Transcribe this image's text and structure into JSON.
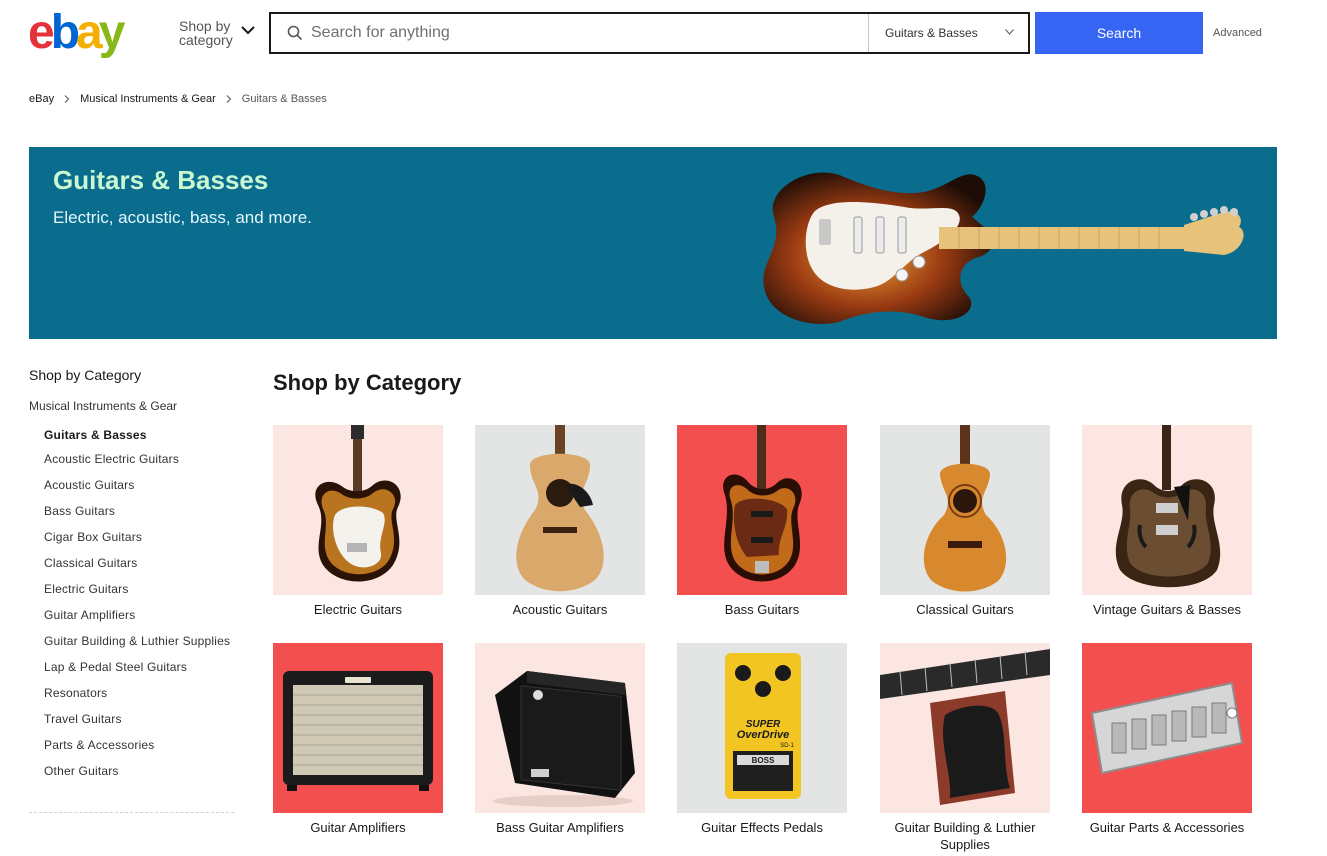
{
  "header": {
    "logo_text": "ebay",
    "shop_by_line1": "Shop by",
    "shop_by_line2": "category",
    "search_placeholder": "Search for anything",
    "category_selected": "Guitars & Basses",
    "search_button": "Search",
    "advanced_link": "Advanced"
  },
  "breadcrumb": [
    "eBay",
    "Musical Instruments & Gear",
    "Guitars & Basses"
  ],
  "hero": {
    "title": "Guitars & Basses",
    "subtitle": "Electric, acoustic, bass, and more.",
    "background": "#0a6d8e"
  },
  "sidebar": {
    "title": "Shop by Category",
    "parent": "Musical Instruments & Gear",
    "items": [
      "Guitars & Basses",
      "Acoustic Electric Guitars",
      "Acoustic Guitars",
      "Bass Guitars",
      "Cigar Box Guitars",
      "Classical Guitars",
      "Electric Guitars",
      "Guitar Amplifiers",
      "Guitar Building & Luthier Supplies",
      "Lap & Pedal Steel Guitars",
      "Resonators",
      "Travel Guitars",
      "Parts & Accessories",
      "Other Guitars"
    ]
  },
  "main": {
    "title": "Shop by Category",
    "categories": [
      {
        "label": "Electric Guitars",
        "bg": "#fbe6e1",
        "icon": "electric-guitar-icon"
      },
      {
        "label": "Acoustic Guitars",
        "bg": "#e3e5e4",
        "icon": "acoustic-guitar-icon"
      },
      {
        "label": "Bass Guitars",
        "bg": "#f44f4f",
        "icon": "bass-guitar-icon"
      },
      {
        "label": "Classical Guitars",
        "bg": "#e3e5e4",
        "icon": "classical-guitar-icon"
      },
      {
        "label": "Vintage Guitars & Basses",
        "bg": "#fbe6e1",
        "icon": "vintage-guitar-icon"
      },
      {
        "label": "Guitar Amplifiers",
        "bg": "#f44f4f",
        "icon": "amplifier-icon"
      },
      {
        "label": "Bass Guitar Amplifiers",
        "bg": "#fbe6e1",
        "icon": "bass-amplifier-icon"
      },
      {
        "label": "Guitar Effects Pedals",
        "bg": "#e3e5e4",
        "icon": "effects-pedal-icon"
      },
      {
        "label": "Guitar Building & Luthier Supplies",
        "bg": "#fbe6e1",
        "icon": "neck-rest-icon"
      },
      {
        "label": "Guitar Parts & Accessories",
        "bg": "#f44f4f",
        "icon": "bridge-icon"
      }
    ]
  },
  "pedal": {
    "brand_line1": "SUPER",
    "brand_line2": "OverDrive",
    "model": "SD-1",
    "brand": "BOSS"
  }
}
